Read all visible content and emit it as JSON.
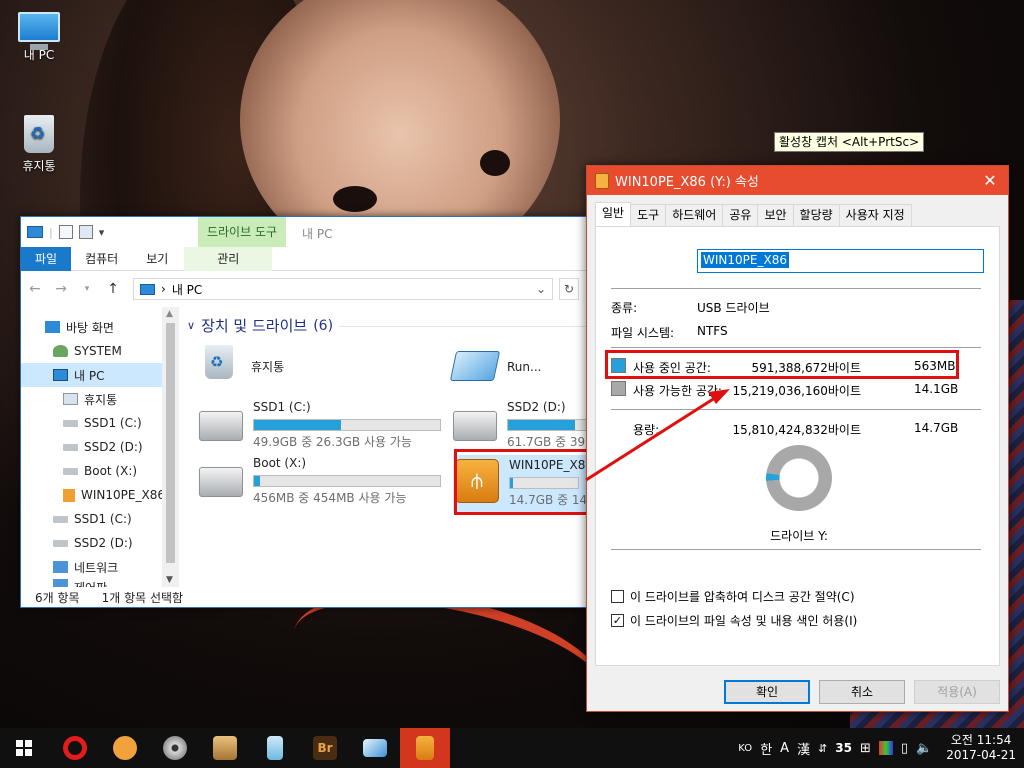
{
  "desktop": {
    "icons": [
      {
        "label": "내 PC"
      },
      {
        "label": "휴지통"
      }
    ]
  },
  "tooltip": "활성창 캡처 <Alt+PrtSc>",
  "explorer": {
    "title": "내 PC",
    "context_tab": "드라이브 도구",
    "ribbon_tabs": [
      "파일",
      "컴퓨터",
      "보기",
      "관리"
    ],
    "address": "내 PC",
    "nav_items": [
      "바탕 화면",
      "SYSTEM",
      "내 PC",
      "휴지통",
      "SSD1 (C:)",
      "SSD2 (D:)",
      "Boot (X:)",
      "WIN10PE_X86",
      "SSD1 (C:)",
      "SSD2 (D:)",
      "네트워크",
      "제어판"
    ],
    "group_title": "장치 및 드라이브",
    "group_count": "(6)",
    "tiles": {
      "recycle": "휴지통",
      "run": "Run...",
      "ssd1": {
        "name": "SSD1 (C:)",
        "free": "49.9GB 중 26.3GB 사용 가능",
        "used_fraction": 0.47
      },
      "ssd2": {
        "name": "SSD2 (D:)",
        "free": "61.7GB 중 39.5",
        "used_fraction": 0.36
      },
      "boot": {
        "name": "Boot (X:)",
        "free": "456MB 중 454MB 사용 가능",
        "used_fraction": 0.01
      },
      "usb": {
        "name": "WIN10PE_X86",
        "free": "14.7GB 중 14.1",
        "used_fraction": 0.04
      }
    },
    "status": {
      "items": "6개 항목",
      "selected": "1개 항목 선택함"
    }
  },
  "properties": {
    "title": "WIN10PE_X86 (Y:) 속성",
    "close": "✕",
    "tabs": [
      "일반",
      "도구",
      "하드웨어",
      "공유",
      "보안",
      "할당량",
      "사용자 지정"
    ],
    "name": "WIN10PE_X86",
    "type_label": "종류:",
    "type_value": "USB 드라이브",
    "fs_label": "파일 시스템:",
    "fs_value": "NTFS",
    "used": {
      "label": "사용 중인 공간:",
      "bytes": "591,388,672바이트",
      "human": "563MB",
      "color": "#26a0da"
    },
    "free": {
      "label": "사용 가능한 공간:",
      "bytes": "15,219,036,160바이트",
      "human": "14.1GB",
      "color": "#a8a8a8"
    },
    "capacity": {
      "label": "용량:",
      "bytes": "15,810,424,832바이트",
      "human": "14.7GB"
    },
    "used_fraction": 0.037,
    "drive_label": "드라이브 Y:",
    "compress": "이 드라이브를 압축하여 디스크 공간 절약(C)",
    "index": "이 드라이브의 파일 속성 및 내용 색인 허용(I)",
    "compress_checked": false,
    "index_checked": true,
    "buttons": {
      "ok": "확인",
      "cancel": "취소",
      "apply": "적용(A)"
    }
  },
  "taskbar": {
    "lang": "KO",
    "ime": [
      "한",
      "A",
      "漢"
    ],
    "badge": "35",
    "time": "오전 11:54",
    "date": "2017-04-21"
  }
}
